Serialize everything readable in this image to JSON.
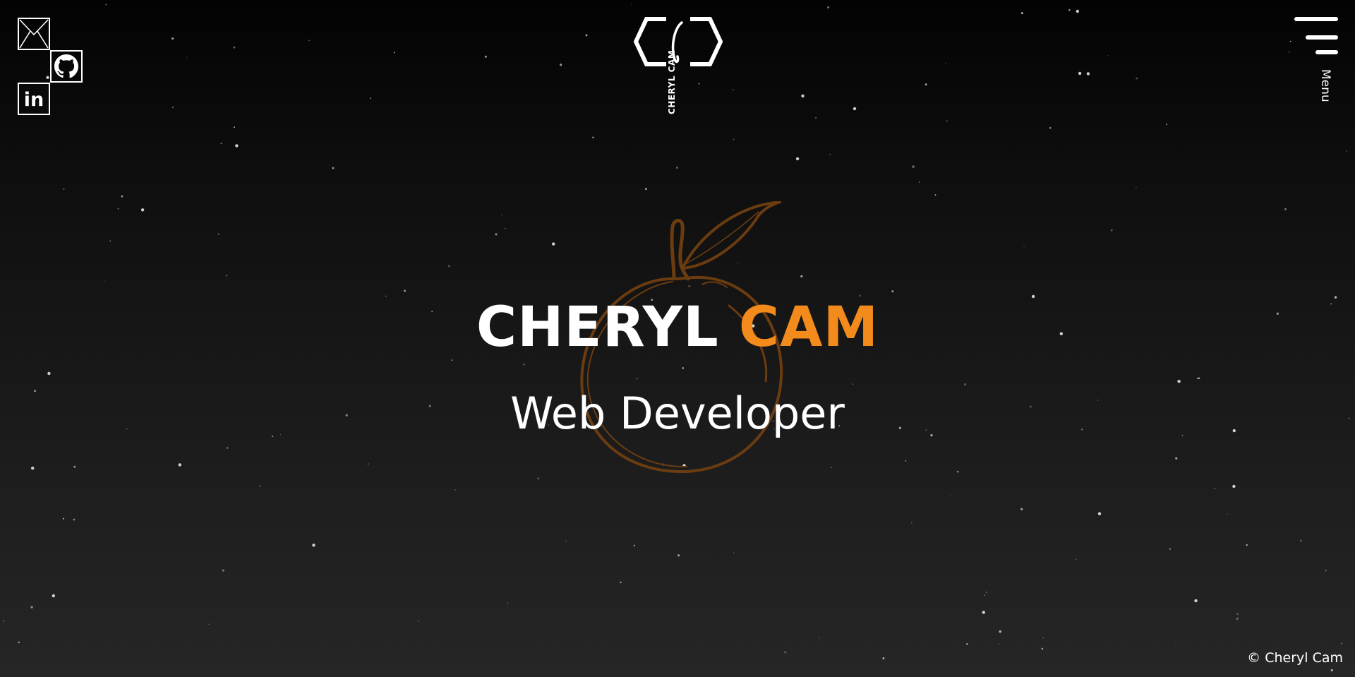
{
  "colors": {
    "accent": "#f38b1c",
    "apple_stroke": "#6b3c10",
    "text": "#ffffff",
    "bg_top": "#030303",
    "bg_bottom": "#262626"
  },
  "social": {
    "mail": {
      "icon": "mail-icon"
    },
    "github": {
      "icon": "github-icon"
    },
    "linkedin": {
      "icon": "linkedin-icon",
      "text": "in"
    }
  },
  "logo": {
    "text": "CHERYL CAM",
    "icon": "cc-monogram-icon"
  },
  "menu": {
    "label": "Menu",
    "icon": "hamburger-menu-icon"
  },
  "hero": {
    "name_first": "CHERYL",
    "name_last": "CAM",
    "subtitle": "Web Developer",
    "background_icon": "orange-fruit-sketch-icon"
  },
  "footer": {
    "copyright": "© Cheryl Cam"
  }
}
